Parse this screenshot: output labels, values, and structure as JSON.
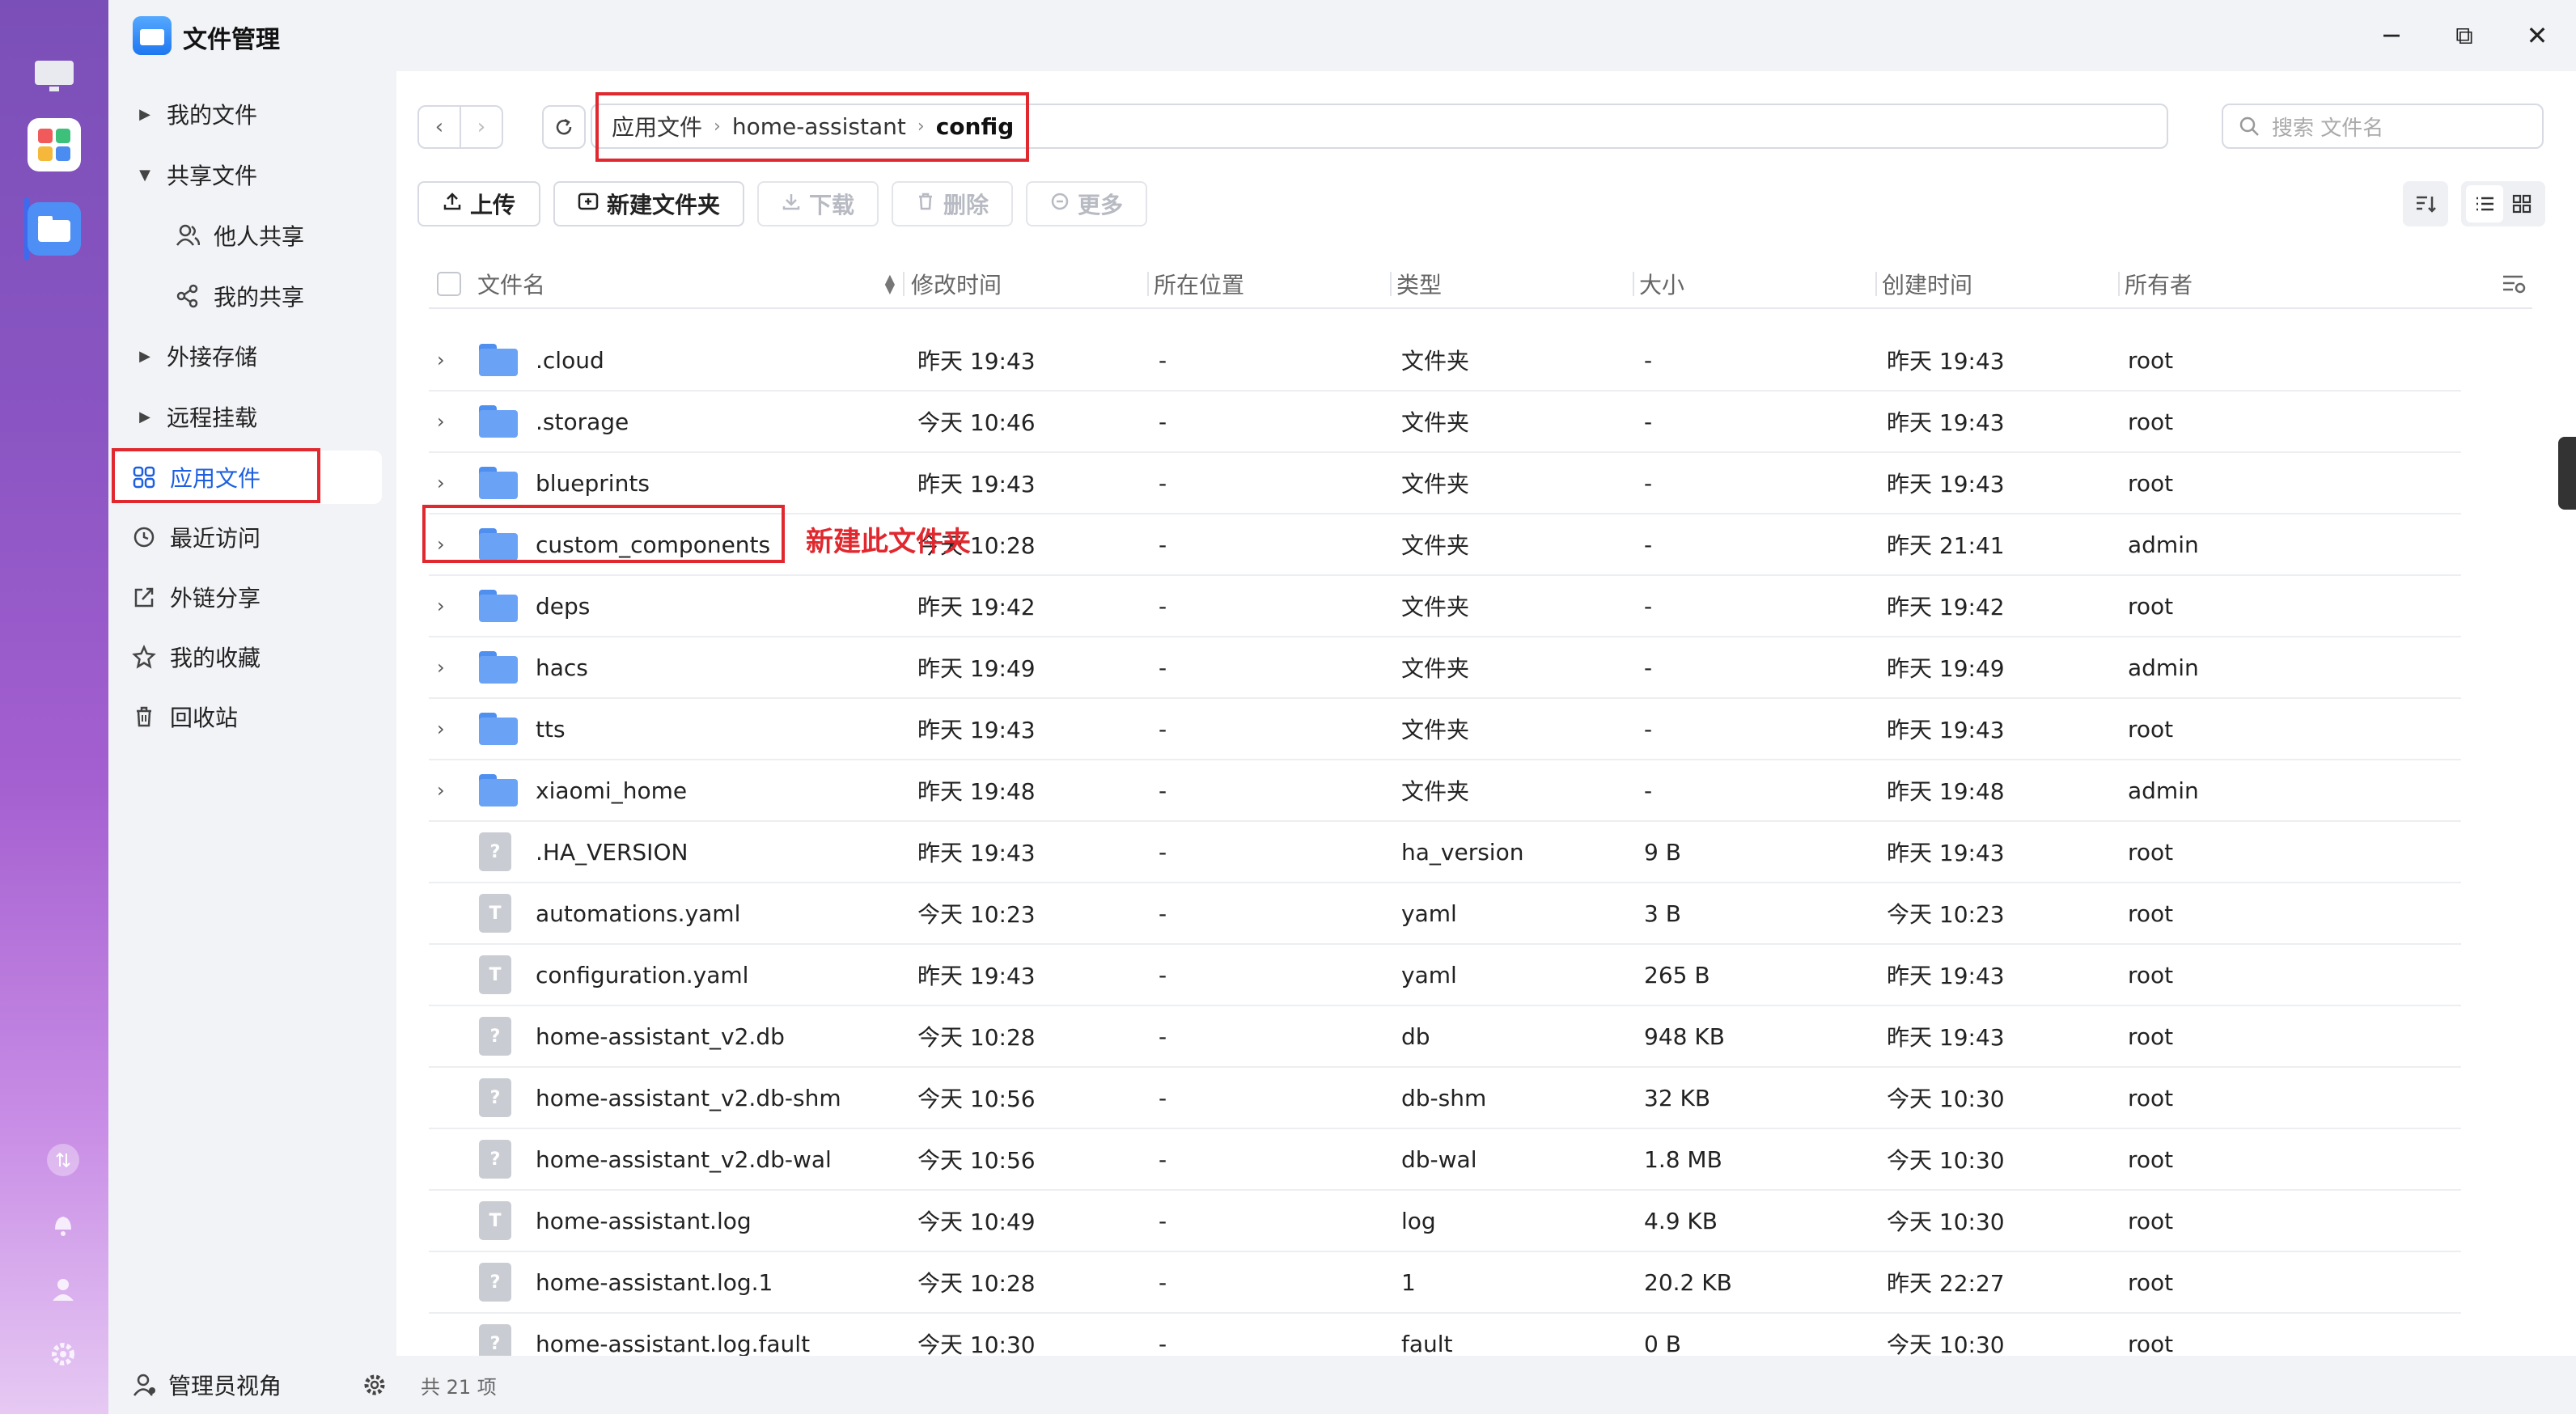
{
  "app": {
    "title": "文件管理"
  },
  "window_controls": {
    "minimize": "─",
    "maximize": "⧉",
    "close": "✕"
  },
  "sidebar": {
    "items": [
      {
        "label": "我的文件",
        "caret": "▶"
      },
      {
        "label": "共享文件",
        "caret": "▼"
      },
      {
        "label": "他人共享"
      },
      {
        "label": "我的共享"
      },
      {
        "label": "外接存储",
        "caret": "▶"
      },
      {
        "label": "远程挂载",
        "caret": "▶"
      },
      {
        "label": "应用文件"
      },
      {
        "label": "最近访问"
      },
      {
        "label": "外链分享"
      },
      {
        "label": "我的收藏"
      },
      {
        "label": "回收站"
      }
    ],
    "bottom_label": "管理员视角"
  },
  "path": {
    "segments": [
      "应用文件",
      "home-assistant",
      "config"
    ],
    "separator": "›"
  },
  "search": {
    "placeholder": "搜索 文件名"
  },
  "toolbar": {
    "upload": "上传",
    "new_folder": "新建文件夹",
    "download": "下载",
    "delete": "删除",
    "more": "更多"
  },
  "columns": [
    "文件名",
    "修改时间",
    "所在位置",
    "类型",
    "大小",
    "创建时间",
    "所有者"
  ],
  "files": [
    {
      "name": ".cloud",
      "kind": "folder",
      "modified": "昨天 19:43",
      "location": "-",
      "type": "文件夹",
      "size": "-",
      "created": "昨天 19:43",
      "owner": "root"
    },
    {
      "name": ".storage",
      "kind": "folder",
      "modified": "今天 10:46",
      "location": "-",
      "type": "文件夹",
      "size": "-",
      "created": "昨天 19:43",
      "owner": "root"
    },
    {
      "name": "blueprints",
      "kind": "folder",
      "modified": "昨天 19:43",
      "location": "-",
      "type": "文件夹",
      "size": "-",
      "created": "昨天 19:43",
      "owner": "root"
    },
    {
      "name": "custom_components",
      "kind": "folder",
      "modified": "今天 10:28",
      "location": "-",
      "type": "文件夹",
      "size": "-",
      "created": "昨天 21:41",
      "owner": "admin"
    },
    {
      "name": "deps",
      "kind": "folder",
      "modified": "昨天 19:42",
      "location": "-",
      "type": "文件夹",
      "size": "-",
      "created": "昨天 19:42",
      "owner": "root"
    },
    {
      "name": "hacs",
      "kind": "folder",
      "modified": "昨天 19:49",
      "location": "-",
      "type": "文件夹",
      "size": "-",
      "created": "昨天 19:49",
      "owner": "admin"
    },
    {
      "name": "tts",
      "kind": "folder",
      "modified": "昨天 19:43",
      "location": "-",
      "type": "文件夹",
      "size": "-",
      "created": "昨天 19:43",
      "owner": "root"
    },
    {
      "name": "xiaomi_home",
      "kind": "folder",
      "modified": "昨天 19:48",
      "location": "-",
      "type": "文件夹",
      "size": "-",
      "created": "昨天 19:48",
      "owner": "admin"
    },
    {
      "name": ".HA_VERSION",
      "kind": "unknown",
      "modified": "昨天 19:43",
      "location": "-",
      "type": "ha_version",
      "size": "9 B",
      "created": "昨天 19:43",
      "owner": "root"
    },
    {
      "name": "automations.yaml",
      "kind": "text",
      "modified": "今天 10:23",
      "location": "-",
      "type": "yaml",
      "size": "3 B",
      "created": "今天 10:23",
      "owner": "root"
    },
    {
      "name": "configuration.yaml",
      "kind": "text",
      "modified": "昨天 19:43",
      "location": "-",
      "type": "yaml",
      "size": "265 B",
      "created": "昨天 19:43",
      "owner": "root"
    },
    {
      "name": "home-assistant_v2.db",
      "kind": "unknown",
      "modified": "今天 10:28",
      "location": "-",
      "type": "db",
      "size": "948 KB",
      "created": "昨天 19:43",
      "owner": "root"
    },
    {
      "name": "home-assistant_v2.db-shm",
      "kind": "unknown",
      "modified": "今天 10:56",
      "location": "-",
      "type": "db-shm",
      "size": "32 KB",
      "created": "今天 10:30",
      "owner": "root"
    },
    {
      "name": "home-assistant_v2.db-wal",
      "kind": "unknown",
      "modified": "今天 10:56",
      "location": "-",
      "type": "db-wal",
      "size": "1.8 MB",
      "created": "今天 10:30",
      "owner": "root"
    },
    {
      "name": "home-assistant.log",
      "kind": "text",
      "modified": "今天 10:49",
      "location": "-",
      "type": "log",
      "size": "4.9 KB",
      "created": "今天 10:30",
      "owner": "root"
    },
    {
      "name": "home-assistant.log.1",
      "kind": "unknown",
      "modified": "今天 10:28",
      "location": "-",
      "type": "1",
      "size": "20.2 KB",
      "created": "昨天 22:27",
      "owner": "root"
    },
    {
      "name": "home-assistant.log.fault",
      "kind": "unknown",
      "modified": "今天 10:30",
      "location": "-",
      "type": "fault",
      "size": "0 B",
      "created": "今天 10:30",
      "owner": "root"
    }
  ],
  "file_icon_glyphs": {
    "unknown": "?",
    "text": "T"
  },
  "footer": {
    "count": "共 21 项"
  },
  "annotation": {
    "text": "新建此文件夹",
    "color": "#e0282e"
  },
  "colors": {
    "accent": "#1d5fe0",
    "folder": "#6aa3f5",
    "dock_top": "#7b4fb8"
  }
}
